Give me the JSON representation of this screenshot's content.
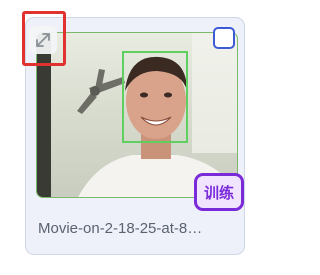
{
  "card": {
    "filename": "Movie-on-2-18-25-at-8…",
    "badge_label": "训练",
    "selected": false
  },
  "icons": {
    "expand": "expand-arrows-icon"
  },
  "colors": {
    "card_bg": "#eef1fa",
    "face_box": "#5fcf5f",
    "highlight": "#e0332f",
    "checkbox_border": "#3d5bd4",
    "badge": "#7a2bd9",
    "filename_text": "#5a6270"
  }
}
